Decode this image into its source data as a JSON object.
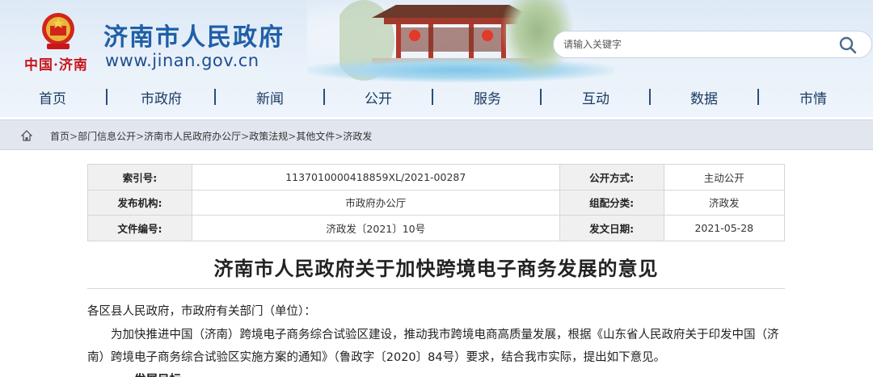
{
  "header": {
    "site_title": "济南市人民政府",
    "site_url": "www.jinan.gov.cn",
    "logo_text": "中国·济南",
    "search_placeholder": "请输入关键字"
  },
  "nav": {
    "items": [
      {
        "label": "首页"
      },
      {
        "label": "市政府"
      },
      {
        "label": "新闻"
      },
      {
        "label": "公开"
      },
      {
        "label": "服务"
      },
      {
        "label": "互动"
      },
      {
        "label": "数据"
      },
      {
        "label": "市情"
      }
    ]
  },
  "breadcrumb": {
    "items": [
      "首页",
      "部门信息公开",
      "济南市人民政府办公厅",
      "政策法规",
      "其他文件",
      "济政发"
    ],
    "separator": ">"
  },
  "info": {
    "rows": [
      {
        "k1": "索引号:",
        "v1": "1137010000418859XL/2021-00287",
        "k2": "公开方式:",
        "v2": "主动公开"
      },
      {
        "k1": "发布机构:",
        "v1": "市政府办公厅",
        "k2": "组配分类:",
        "v2": "济政发"
      },
      {
        "k1": "文件编号:",
        "v1": "济政发〔2021〕10号",
        "k2": "发文日期:",
        "v2": "2021-05-28"
      }
    ]
  },
  "article": {
    "title": "济南市人民政府关于加快跨境电子商务发展的意见",
    "salutation": "各区县人民政府，市政府有关部门（单位）：",
    "body": "为加快推进中国（济南）跨境电子商务综合试验区建设，推动我市跨境电商高质量发展，根据《山东省人民政府关于印发中国（济南）跨境电子商务综合试验区实施方案的通知》（鲁政字〔2020〕84号）要求，结合我市实际，提出如下意见。",
    "heading": "一、发展目标"
  },
  "colors": {
    "brand_blue": "#1f5fa8",
    "logo_red": "#c8161d",
    "nav_text": "#1b3a63",
    "crumb_bg": "#e2e7ef",
    "table_key_bg": "#f0f0f0"
  }
}
